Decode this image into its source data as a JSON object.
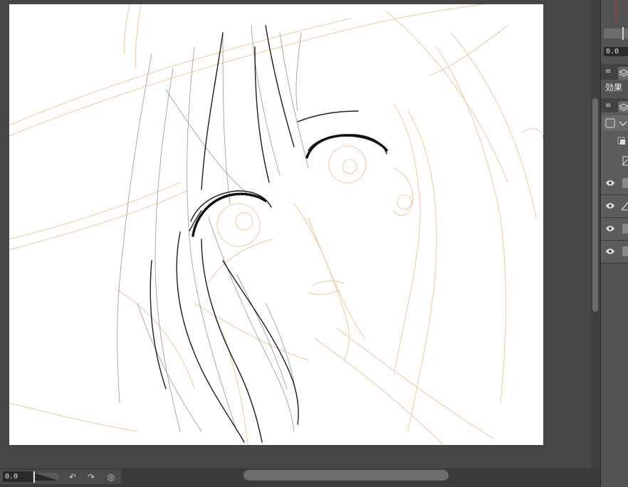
{
  "status_bar": {
    "zoom_value": "0.0",
    "zoom_level": 0.25,
    "buttons": [
      {
        "name": "rotate-left-icon",
        "glyph": "↶"
      },
      {
        "name": "rotate-right-icon",
        "glyph": "↷"
      },
      {
        "name": "reset-view-icon",
        "glyph": "◎"
      }
    ]
  },
  "layer_panel": {
    "opacity_value": "0.0",
    "effect_label": "効果",
    "menu_glyph": "≡",
    "layers": [
      {
        "visible": true,
        "icon": "eye-icon"
      },
      {
        "visible": true,
        "icon": "eye-icon"
      },
      {
        "visible": true,
        "icon": "eye-icon"
      },
      {
        "visible": true,
        "icon": "eye-icon"
      }
    ]
  },
  "colors": {
    "canvas": "#ffffff",
    "sketch_line": "#1a1a1a",
    "rough_sketch": "#f2c9a0",
    "panel_bg": "#535353",
    "accent_red": "#c0392b"
  }
}
